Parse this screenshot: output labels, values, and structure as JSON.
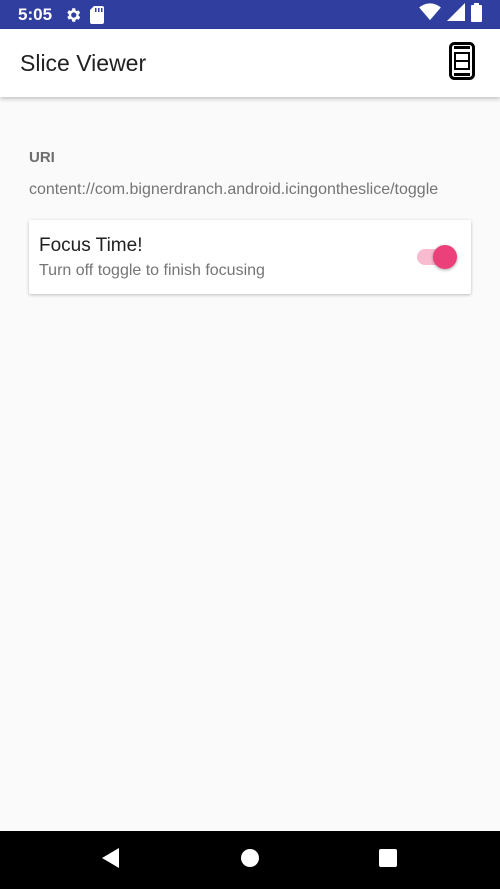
{
  "status_bar": {
    "time": "5:05",
    "icons": [
      "gear-icon",
      "sd-card-icon",
      "wifi-icon",
      "signal-icon",
      "battery-icon"
    ]
  },
  "app_bar": {
    "title": "Slice Viewer",
    "action_icon": "slice-mode-icon"
  },
  "content": {
    "uri_label": "URI",
    "uri_value": "content://com.bignerdranch.android.icingontheslice/toggle",
    "slice": {
      "title": "Focus Time!",
      "subtitle": "Turn off toggle to finish focusing",
      "toggle_on": true
    }
  },
  "nav_bar": {
    "buttons": [
      "back-icon",
      "home-icon",
      "recents-icon"
    ]
  },
  "colors": {
    "status_bar": "#303f9f",
    "accent": "#ec407a",
    "accent_track": "#f8bbd0"
  }
}
